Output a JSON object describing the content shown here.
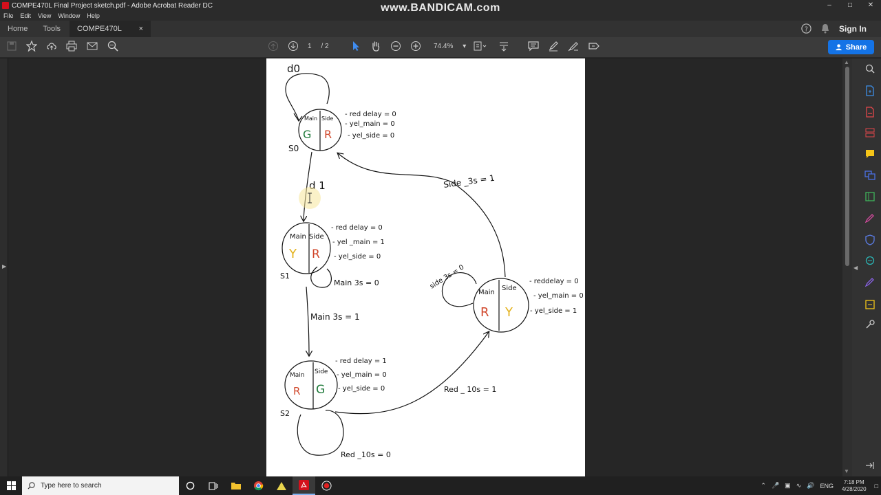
{
  "window": {
    "title": "COMPE470L Final Project sketch.pdf - Adobe Acrobat Reader DC",
    "watermark": "www.BANDICAM.com",
    "controls": {
      "minimize": "–",
      "maximize": "□",
      "close": "✕"
    }
  },
  "menu": [
    "File",
    "Edit",
    "View",
    "Window",
    "Help"
  ],
  "tabs": {
    "home": "Home",
    "tools": "Tools",
    "document": "COMPE470L Final ...",
    "close": "×"
  },
  "header": {
    "sign_in": "Sign In",
    "share": "Share"
  },
  "toolbar": {
    "page_current": "1",
    "page_sep": "/",
    "page_total": "2",
    "zoom": "74.4%"
  },
  "diagram": {
    "s0": {
      "label": "S0",
      "loop": "d0",
      "left_head": "Main",
      "right_head": "Side",
      "left": "G",
      "right": "R",
      "outputs": [
        "- red delay = 0",
        "- yel_main = 0",
        "- yel_side = 0"
      ]
    },
    "s1": {
      "label": "S1",
      "left_head": "Main",
      "right_head": "Side",
      "left": "Y",
      "right": "R",
      "outputs": [
        "- red delay = 0",
        "- yel _main = 1",
        "- yel_side = 0"
      ],
      "loop": "Main 3s = 0"
    },
    "s2": {
      "label": "S2",
      "left_head": "Main",
      "right_head": "Side",
      "left": "R",
      "right": "G",
      "outputs": [
        "- red delay = 1",
        "- yel_main = 0",
        "- yel_side = 0"
      ],
      "loop": "Red _10s = 0"
    },
    "s3": {
      "left_head": "Main",
      "right_head": "Side",
      "left": "R",
      "right": "Y",
      "outputs": [
        "- reddelay = 0",
        "- yel_main = 0",
        "- yel_side = 1"
      ],
      "loop": "side 3s = 0"
    },
    "t_s0_s1": "d 1",
    "t_s1_s2": "Main 3s = 1",
    "t_s2_s3": "Red _ 10s = 1",
    "t_s3_s0": "Side _3s = 1",
    "colors": {
      "green": "#1f7a3a",
      "red": "#d0462a",
      "yellow": "#e3b21c"
    }
  },
  "taskbar": {
    "search_placeholder": "Type here to search",
    "language": "ENG",
    "time": "7:18 PM",
    "date": "4/28/2020"
  }
}
